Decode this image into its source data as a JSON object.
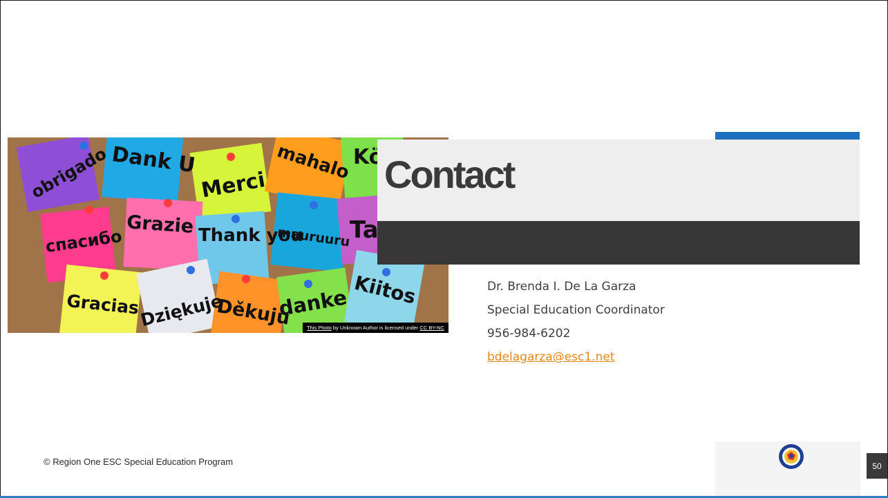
{
  "slide": {
    "title": "Contact",
    "contact": {
      "name": "Dr. Brenda I. De La Garza",
      "role": "Special Education Coordinator",
      "phone": "956-984-6202",
      "email": "bdelagarza@esc1.net"
    },
    "footer": "© Region One ESC Special Education Program",
    "page_number": "50"
  },
  "photo": {
    "notes": [
      "obrigado",
      "Dank U",
      "Merci",
      "mahalo",
      "Kö",
      "спасибо",
      "Grazie",
      "Thank you",
      "mauruuru",
      "Takk",
      "Gracias",
      "Dziękuję",
      "Děkuju",
      "danke",
      "Kiitos"
    ],
    "attribution": {
      "link1": "This Photo",
      "middle": " by Unknown Author is licensed under ",
      "link2": "CC BY-NC"
    }
  },
  "colors": {
    "accent_blue": "#1d6fbf",
    "link_orange": "#e8871a",
    "dark_bar": "#373737"
  }
}
